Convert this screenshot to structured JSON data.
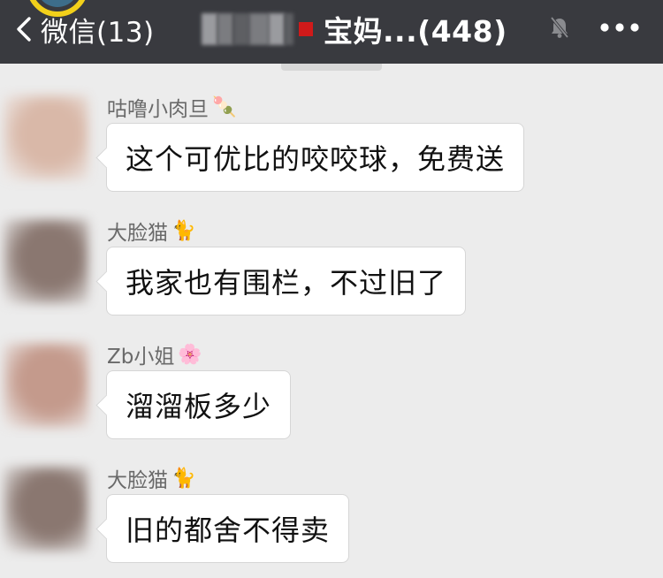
{
  "header": {
    "back_label": "微信(13)",
    "title": "宝妈...(448)",
    "icons": {
      "back": "chevron-left-icon",
      "mute": "bell-off-icon",
      "more": "more-dots-icon"
    },
    "colors": {
      "bar": "#393a3f",
      "text": "#ffffff"
    }
  },
  "chat": {
    "background": "#ececec",
    "messages": [
      {
        "sender": "咕噜小肉旦",
        "sender_emoji": "🍡",
        "text": "这个可优比的咬咬球，免费送",
        "avatar_color": "#d9b8a8"
      },
      {
        "sender": "大脸猫",
        "sender_emoji": "🐈",
        "text": "我家也有围栏，不过旧了",
        "avatar_color": "#8a7770"
      },
      {
        "sender": "Zb小姐",
        "sender_emoji": "🌸",
        "text": "溜溜板多少",
        "avatar_color": "#c49a8c"
      },
      {
        "sender": "大脸猫",
        "sender_emoji": "🐈",
        "text": "旧的都舍不得卖",
        "avatar_color": "#8a7770"
      }
    ]
  }
}
